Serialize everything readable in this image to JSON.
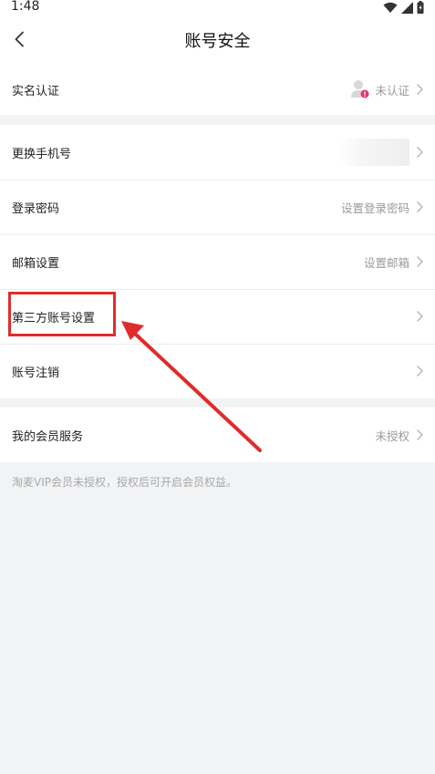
{
  "status": {
    "time": "1:48"
  },
  "header": {
    "title": "账号安全"
  },
  "section1": {
    "real_name": {
      "label": "实名认证",
      "value": "未认证"
    }
  },
  "section2": {
    "rows": [
      {
        "label": "更换手机号",
        "value": ""
      },
      {
        "label": "登录密码",
        "value": "设置登录密码"
      },
      {
        "label": "邮箱设置",
        "value": "设置邮箱"
      },
      {
        "label": "第三方账号设置",
        "value": ""
      },
      {
        "label": "账号注销",
        "value": ""
      }
    ]
  },
  "section3": {
    "member": {
      "label": "我的会员服务",
      "value": "未授权"
    }
  },
  "footnote": "淘麦VIP会员未授权，授权后可开启会员权益。",
  "colors": {
    "annotation_red": "#e12b2b",
    "badge_pink": "#e8336d",
    "background": "#f2f3f5"
  },
  "icons": [
    "back-arrow-icon",
    "wifi-icon",
    "signal-icon",
    "battery-icon",
    "avatar-icon",
    "chevron-right-icon"
  ]
}
